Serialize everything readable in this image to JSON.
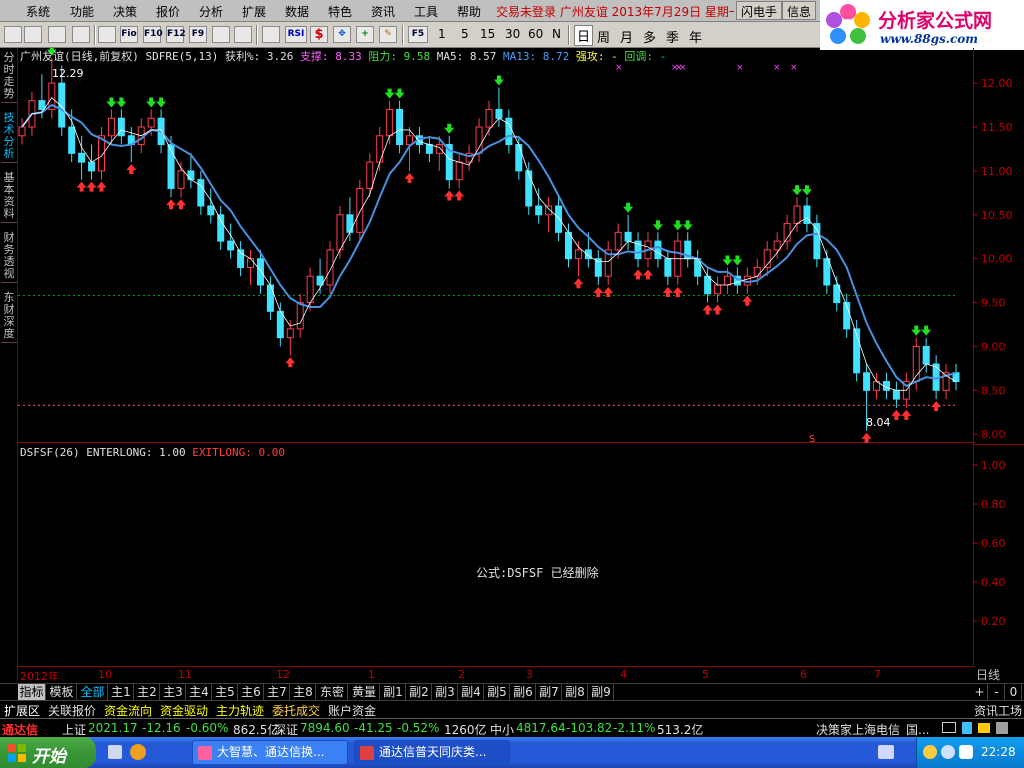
{
  "menu": [
    "系统",
    "功能",
    "决策",
    "报价",
    "分析",
    "扩展",
    "数据",
    "特色",
    "资讯",
    "工具",
    "帮助"
  ],
  "ticker": "交易未登录  广州友谊  2013年7月29日 星期一",
  "flash_buttons": [
    "闪电手",
    "信息"
  ],
  "logo": {
    "title": "分析家公式网",
    "url": "www.88gs.com"
  },
  "toolbar": {
    "text_icons": [
      "Fio",
      "F10",
      "F12",
      "F9"
    ],
    "rsi": "RSI",
    "f5": "F5",
    "numbers": [
      "1",
      "5",
      "15",
      "30",
      "60",
      "N"
    ],
    "periods": [
      "日",
      "周",
      "月",
      "多",
      "季",
      "年"
    ]
  },
  "side_tabs": [
    "分时走势",
    "技术分析",
    "基本资料",
    "财务透视",
    "东财深度"
  ],
  "main_legend": {
    "name": "广州友谊(日线,前复权)",
    "formula": "SDFRE(5,13)",
    "profit_label": "获利%:",
    "profit": "3.26",
    "support_label": "支撑:",
    "support": "8.33",
    "resistance_label": "阻力:",
    "resistance": "9.58",
    "ma5_label": "MA5:",
    "ma5": "8.57",
    "ma13_label": "MA13:",
    "ma13": "8.72",
    "strong_label": "强攻:",
    "strong": "-",
    "pullback_label": "回调:",
    "pullback": "-"
  },
  "sub_legend": {
    "name": "DSFSF(26)",
    "enter_label": "ENTERLONG:",
    "enter": "1.00",
    "exit_label": "EXITLONG:",
    "exit": "0.00"
  },
  "sub_message": "公式:DSFSF 已经删除",
  "high_label": "12.29",
  "low_label": "8.04",
  "s_marker": "S",
  "price_axis": [
    "12.00",
    "11.50",
    "11.00",
    "10.50",
    "10.00",
    "9.50",
    "9.00",
    "8.50",
    "8.00"
  ],
  "sub_axis": [
    "1.00",
    "0.80",
    "0.60",
    "0.40",
    "0.20"
  ],
  "time_axis": [
    "2012年",
    "10",
    "11",
    "12",
    "1",
    "2",
    "3",
    "4",
    "5",
    "6",
    "7"
  ],
  "daily_label": "日线",
  "indicator_tabs": [
    "指标",
    "模板",
    "全部",
    "主1",
    "主2",
    "主3",
    "主4",
    "主5",
    "主6",
    "主7",
    "主8",
    "东密",
    "黄量",
    "副1",
    "副2",
    "副3",
    "副4",
    "副5",
    "副6",
    "副7",
    "副8",
    "副9"
  ],
  "nav_buttons": [
    "+",
    "-",
    "0"
  ],
  "quick_tabs": [
    "扩展区",
    "关联报价",
    "资金流向",
    "资金驱动",
    "主力轨迹",
    "委托成交",
    "账户资金"
  ],
  "quick_right": "资讯工场",
  "status": {
    "app": "通达信",
    "sh_label": "上证",
    "sh_index": "2021.17",
    "sh_change": "-12.16",
    "sh_pct": "-0.60%",
    "sh_amount": "862.5亿",
    "sz_label": "深证",
    "sz_index": "7894.60",
    "sz_change": "-41.25",
    "sz_pct": "-0.52%",
    "sz_amount": "1260亿",
    "zx_label": "中小",
    "zx_index": "4817.64",
    "zx_change": "-103.82",
    "zx_pct": "-2.11%",
    "zx_amount": "513.2亿",
    "server": "决策家上海电信",
    "extra": "国..."
  },
  "taskbar": {
    "start": "开始",
    "tasks": [
      "大智慧、通达信换...",
      "通达信普天同庆类..."
    ],
    "clock": "22:28"
  },
  "colors": {
    "up": "#ff3c50",
    "down": "#40e0ff",
    "ma_long": "#4a90e0",
    "ma_short": "#ffffff",
    "support_line": "#00a000",
    "resistance_line": "#ff6060",
    "axis_red": "#c00000"
  },
  "chart_data": {
    "type": "candlestick",
    "y_range": [
      7.9,
      12.4
    ],
    "support": 8.33,
    "resistance": 9.58,
    "candles": [
      [
        11.4,
        11.6,
        11.3,
        11.5
      ],
      [
        11.5,
        11.9,
        11.4,
        11.8
      ],
      [
        11.8,
        12.1,
        11.6,
        11.7
      ],
      [
        11.7,
        12.29,
        11.6,
        12.0
      ],
      [
        12.0,
        12.2,
        11.4,
        11.5
      ],
      [
        11.5,
        11.7,
        11.1,
        11.2
      ],
      [
        11.2,
        11.4,
        10.9,
        11.1
      ],
      [
        11.1,
        11.3,
        10.9,
        11.0
      ],
      [
        11.0,
        11.5,
        10.9,
        11.4
      ],
      [
        11.4,
        11.7,
        11.3,
        11.6
      ],
      [
        11.6,
        11.7,
        11.3,
        11.4
      ],
      [
        11.4,
        11.5,
        11.1,
        11.3
      ],
      [
        11.3,
        11.6,
        11.2,
        11.5
      ],
      [
        11.5,
        11.7,
        11.4,
        11.6
      ],
      [
        11.6,
        11.7,
        11.2,
        11.3
      ],
      [
        11.3,
        11.4,
        10.7,
        10.8
      ],
      [
        10.8,
        11.1,
        10.7,
        11.0
      ],
      [
        11.0,
        11.2,
        10.8,
        10.9
      ],
      [
        10.9,
        11.0,
        10.5,
        10.6
      ],
      [
        10.6,
        10.8,
        10.4,
        10.5
      ],
      [
        10.5,
        10.6,
        10.1,
        10.2
      ],
      [
        10.2,
        10.4,
        10.0,
        10.1
      ],
      [
        10.1,
        10.2,
        9.8,
        9.9
      ],
      [
        9.9,
        10.1,
        9.7,
        10.0
      ],
      [
        10.0,
        10.1,
        9.6,
        9.7
      ],
      [
        9.7,
        9.8,
        9.3,
        9.4
      ],
      [
        9.4,
        9.5,
        9.0,
        9.1
      ],
      [
        9.1,
        9.3,
        8.9,
        9.2
      ],
      [
        9.2,
        9.6,
        9.1,
        9.5
      ],
      [
        9.5,
        9.9,
        9.4,
        9.8
      ],
      [
        9.8,
        10.0,
        9.6,
        9.7
      ],
      [
        9.7,
        10.2,
        9.6,
        10.1
      ],
      [
        10.1,
        10.6,
        10.0,
        10.5
      ],
      [
        10.5,
        10.7,
        10.2,
        10.3
      ],
      [
        10.3,
        10.9,
        10.2,
        10.8
      ],
      [
        10.8,
        11.2,
        10.7,
        11.1
      ],
      [
        11.1,
        11.5,
        11.0,
        11.4
      ],
      [
        11.4,
        11.8,
        11.3,
        11.7
      ],
      [
        11.7,
        11.8,
        11.2,
        11.3
      ],
      [
        11.3,
        11.5,
        11.0,
        11.4
      ],
      [
        11.4,
        11.5,
        11.2,
        11.3
      ],
      [
        11.3,
        11.4,
        11.1,
        11.2
      ],
      [
        11.2,
        11.4,
        11.0,
        11.3
      ],
      [
        11.3,
        11.4,
        10.8,
        10.9
      ],
      [
        10.9,
        11.2,
        10.8,
        11.1
      ],
      [
        11.1,
        11.3,
        11.0,
        11.2
      ],
      [
        11.2,
        11.6,
        11.1,
        11.5
      ],
      [
        11.5,
        11.8,
        11.4,
        11.7
      ],
      [
        11.7,
        11.95,
        11.5,
        11.6
      ],
      [
        11.6,
        11.7,
        11.2,
        11.3
      ],
      [
        11.3,
        11.4,
        10.9,
        11.0
      ],
      [
        11.0,
        11.1,
        10.5,
        10.6
      ],
      [
        10.6,
        10.8,
        10.4,
        10.5
      ],
      [
        10.5,
        10.7,
        10.3,
        10.6
      ],
      [
        10.6,
        10.7,
        10.2,
        10.3
      ],
      [
        10.3,
        10.4,
        9.9,
        10.0
      ],
      [
        10.0,
        10.2,
        9.8,
        10.1
      ],
      [
        10.1,
        10.3,
        9.9,
        10.0
      ],
      [
        10.0,
        10.1,
        9.7,
        9.8
      ],
      [
        9.8,
        10.2,
        9.7,
        10.1
      ],
      [
        10.1,
        10.4,
        10.0,
        10.3
      ],
      [
        10.3,
        10.5,
        10.1,
        10.2
      ],
      [
        10.2,
        10.3,
        9.9,
        10.0
      ],
      [
        10.0,
        10.3,
        9.9,
        10.2
      ],
      [
        10.2,
        10.3,
        9.9,
        10.0
      ],
      [
        10.0,
        10.1,
        9.7,
        9.8
      ],
      [
        9.8,
        10.3,
        9.7,
        10.2
      ],
      [
        10.2,
        10.3,
        9.9,
        10.0
      ],
      [
        10.0,
        10.1,
        9.7,
        9.8
      ],
      [
        9.8,
        9.9,
        9.5,
        9.6
      ],
      [
        9.6,
        9.8,
        9.5,
        9.7
      ],
      [
        9.7,
        9.9,
        9.6,
        9.8
      ],
      [
        9.8,
        9.9,
        9.6,
        9.7
      ],
      [
        9.7,
        9.9,
        9.6,
        9.8
      ],
      [
        9.8,
        10.0,
        9.7,
        9.9
      ],
      [
        9.9,
        10.2,
        9.8,
        10.1
      ],
      [
        10.1,
        10.3,
        10.0,
        10.2
      ],
      [
        10.2,
        10.5,
        10.1,
        10.4
      ],
      [
        10.4,
        10.7,
        10.3,
        10.6
      ],
      [
        10.6,
        10.7,
        10.3,
        10.4
      ],
      [
        10.4,
        10.5,
        9.9,
        10.0
      ],
      [
        10.0,
        10.1,
        9.6,
        9.7
      ],
      [
        9.7,
        9.8,
        9.4,
        9.5
      ],
      [
        9.5,
        9.6,
        9.1,
        9.2
      ],
      [
        9.2,
        9.3,
        8.6,
        8.7
      ],
      [
        8.7,
        8.8,
        8.04,
        8.5
      ],
      [
        8.5,
        8.7,
        8.4,
        8.6
      ],
      [
        8.6,
        8.7,
        8.4,
        8.5
      ],
      [
        8.5,
        8.6,
        8.3,
        8.4
      ],
      [
        8.4,
        8.7,
        8.3,
        8.6
      ],
      [
        8.6,
        9.1,
        8.5,
        9.0
      ],
      [
        9.0,
        9.1,
        8.7,
        8.8
      ],
      [
        8.8,
        8.9,
        8.4,
        8.5
      ],
      [
        8.5,
        8.8,
        8.4,
        8.7
      ],
      [
        8.7,
        8.8,
        8.5,
        8.6
      ]
    ]
  }
}
